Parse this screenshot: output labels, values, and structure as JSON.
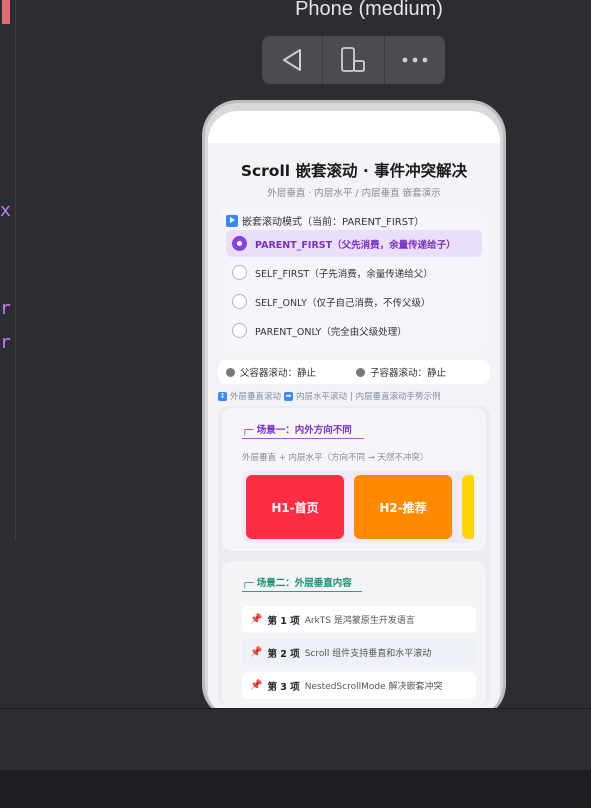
{
  "editor": {
    "code_fragments": [
      "x",
      "r",
      "r"
    ]
  },
  "preview": {
    "device_title": "Phone (medium)",
    "toolbar": {
      "buttons": [
        {
          "icon": "back-triangle-icon"
        },
        {
          "icon": "device-rotate-icon"
        },
        {
          "icon": "more-dots-icon"
        }
      ]
    }
  },
  "app": {
    "title": "Scroll 嵌套滚动 · 事件冲突解决",
    "subtitle": "外层垂直 · 内层水平 / 内层垂直 嵌套演示",
    "mode": {
      "heading": "嵌套滚动模式（当前：PARENT_FIRST）",
      "options": [
        {
          "label": "PARENT_FIRST（父先消费，余量传递给子）",
          "selected": true
        },
        {
          "label": "SELF_FIRST（子先消费，余量传递给父）",
          "selected": false
        },
        {
          "label": "SELF_ONLY（仅子自己消费，不传父级）",
          "selected": false
        },
        {
          "label": "PARENT_ONLY（完全由父级处理）",
          "selected": false
        }
      ]
    },
    "status": {
      "parent": "父容器滚动：静止",
      "child": "子容器滚动：静止"
    },
    "legend": {
      "outer": "外层垂直滚动",
      "inner": "内层水平滚动",
      "rest": "| 内层垂直滚动手势示例"
    },
    "scene1": {
      "title": "场景一：内外方向不同",
      "desc": "外层垂直 + 内层水平（方向不同 → 天然不冲突）",
      "boxes": [
        {
          "label": "H1-首页",
          "color": "#ff2d43"
        },
        {
          "label": "H2-推荐",
          "color": "#ff8a00"
        },
        {
          "label": "",
          "color": "#ffd500"
        }
      ]
    },
    "scene2": {
      "title": "场景二：外层垂直内容",
      "items": [
        {
          "no": "第 1 项",
          "text": "ArkTS 是鸿蒙原生开发语言"
        },
        {
          "no": "第 2 项",
          "text": "Scroll 组件支持垂直和水平滚动"
        },
        {
          "no": "第 3 项",
          "text": "NestedScrollMode 解决嵌套冲突"
        }
      ]
    }
  }
}
